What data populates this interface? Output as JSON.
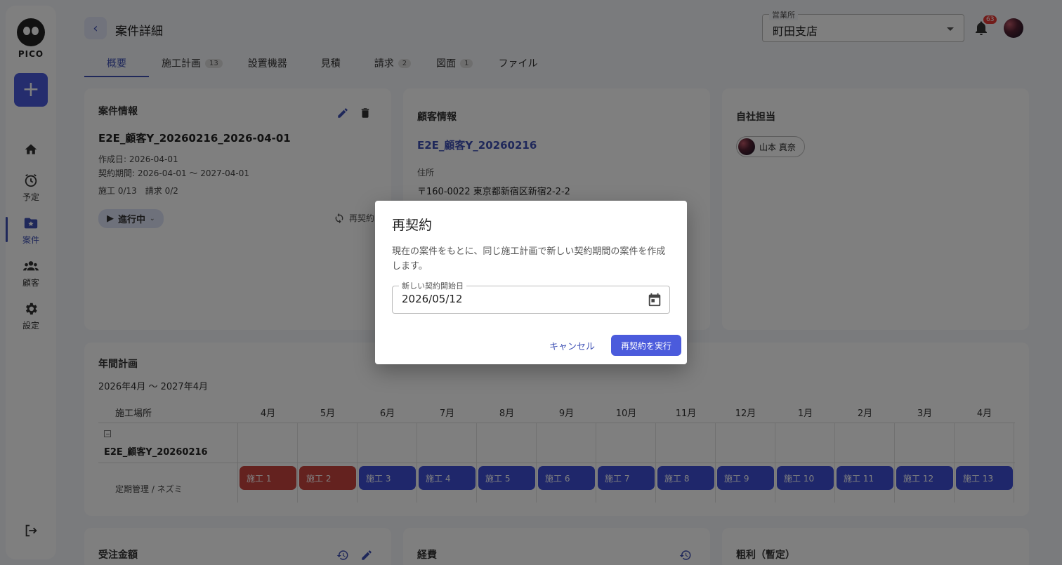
{
  "app": {
    "logo_text": "PICO"
  },
  "sidebar": {
    "items": [
      {
        "label": "",
        "icon": "home-icon"
      },
      {
        "label": "予定",
        "icon": "alarm-icon"
      },
      {
        "label": "案件",
        "icon": "folder-star-icon"
      },
      {
        "label": "顧客",
        "icon": "people-icon"
      },
      {
        "label": "設定",
        "icon": "gear-icon"
      }
    ]
  },
  "header": {
    "title": "案件詳細",
    "office_label": "営業所",
    "office_value": "町田支店",
    "notification_count": "63"
  },
  "tabs": [
    {
      "label": "概要",
      "count": ""
    },
    {
      "label": "施工計画",
      "count": "13"
    },
    {
      "label": "設置機器",
      "count": ""
    },
    {
      "label": "見積",
      "count": ""
    },
    {
      "label": "請求",
      "count": "2"
    },
    {
      "label": "図面",
      "count": "1"
    },
    {
      "label": "ファイル",
      "count": ""
    }
  ],
  "case_info": {
    "heading": "案件情報",
    "name": "E2E_顧客Y_20260216_2026-04-01",
    "created": "作成日: 2026-04-01",
    "period": "契約期間: 2026-04-01 〜 2027-04-01",
    "progress": "施工 0/13　請求 0/2",
    "status": "進行中",
    "renew": "再契約"
  },
  "customer_info": {
    "heading": "顧客情報",
    "name": "E2E_顧客Y_20260216",
    "address_label": "住所",
    "address": "〒160-0022 東京都新宿区新宿2-2-2"
  },
  "staff": {
    "heading": "自社担当",
    "name": "山本 真奈"
  },
  "annual_plan": {
    "heading": "年間計画",
    "range": "2026年4月 〜 2027年4月",
    "place_header": "施工場所",
    "months": [
      "4月",
      "5月",
      "6月",
      "7月",
      "8月",
      "9月",
      "10月",
      "11月",
      "12月",
      "1月",
      "2月",
      "3月",
      "4月"
    ],
    "site": "E2E_顧客Y_20260216",
    "task": "定期管理 / ネズミ",
    "works": [
      "施工 1",
      "施工 2",
      "施工 3",
      "施工 4",
      "施工 5",
      "施工 6",
      "施工 7",
      "施工 8",
      "施工 9",
      "施工 10",
      "施工 11",
      "施工 12",
      "施工 13"
    ]
  },
  "bottom_cards": {
    "order_amount": "受注金額",
    "expenses": "経費",
    "gross_profit": "粗利（暫定）"
  },
  "dialog": {
    "title": "再契約",
    "text": "現在の案件をもとに、同じ施工計画で新しい契約期間の案件を作成します。",
    "date_label": "新しい契約開始日",
    "date_value": "2026/05/12",
    "cancel": "キャンセル",
    "confirm": "再契約を実行"
  },
  "colors": {
    "accent": "#3f51b5",
    "button": "#4b5bdc",
    "done_red": "#c9453f",
    "planned_blue": "#3f4fd6"
  }
}
